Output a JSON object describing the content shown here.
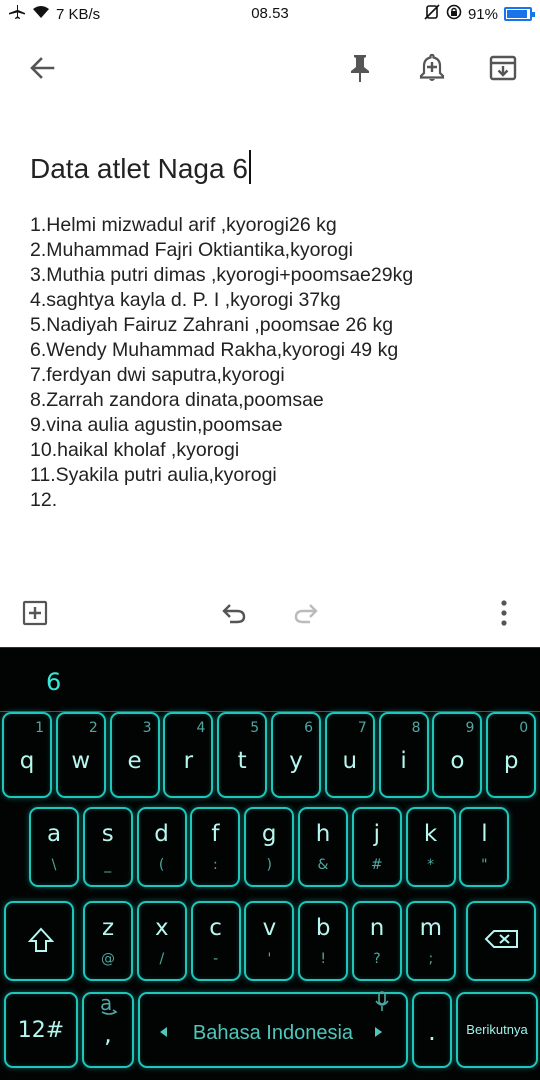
{
  "status_bar": {
    "speed": "7 KB/s",
    "time": "08.53",
    "battery": "91%",
    "battery_level": 0.91
  },
  "toolbar": {
    "back_icon": "arrow-left-icon",
    "pin_icon": "pin-icon",
    "reminder_icon": "bell-plus-icon",
    "archive_icon": "archive-icon"
  },
  "note": {
    "title": "Data atlet Naga 6",
    "lines": [
      "1.Helmi mizwadul arif ,kyorogi26 kg",
      "2.Muhammad Fajri Oktiantika,kyorogi",
      "3.Muthia putri dimas ,kyorogi+poomsae29kg",
      "4.saghtya kayla d. P. I ,kyorogi 37kg",
      "5.Nadiyah Fairuz Zahrani ,poomsae 26 kg",
      "6.Wendy Muhammad Rakha,kyorogi 49 kg",
      "7.ferdyan dwi saputra,kyorogi",
      "8.Zarrah zandora dinata,poomsae",
      "9.vina aulia agustin,poomsae",
      "10.haikal kholaf ,kyorogi",
      "11.Syakila putri aulia,kyorogi",
      "12."
    ]
  },
  "keyboard": {
    "suggestion": "6",
    "row1": [
      {
        "key": "q",
        "num": "1"
      },
      {
        "key": "w",
        "num": "2"
      },
      {
        "key": "e",
        "num": "3"
      },
      {
        "key": "r",
        "num": "4"
      },
      {
        "key": "t",
        "num": "5"
      },
      {
        "key": "y",
        "num": "6"
      },
      {
        "key": "u",
        "num": "7"
      },
      {
        "key": "i",
        "num": "8"
      },
      {
        "key": "o",
        "num": "9"
      },
      {
        "key": "p",
        "num": "0"
      }
    ],
    "row2": [
      {
        "key": "a",
        "sym": "\\"
      },
      {
        "key": "s",
        "sym": "_"
      },
      {
        "key": "d",
        "sym": "("
      },
      {
        "key": "f",
        "sym": ":"
      },
      {
        "key": "g",
        "sym": ")"
      },
      {
        "key": "h",
        "sym": "&"
      },
      {
        "key": "j",
        "sym": "#"
      },
      {
        "key": "k",
        "sym": "*"
      },
      {
        "key": "l",
        "sym": "\""
      }
    ],
    "row3": [
      {
        "key": "z",
        "sym": "@"
      },
      {
        "key": "x",
        "sym": "/"
      },
      {
        "key": "c",
        "sym": "-"
      },
      {
        "key": "v",
        "sym": "'"
      },
      {
        "key": "b",
        "sym": "!"
      },
      {
        "key": "n",
        "sym": "?"
      },
      {
        "key": "m",
        "sym": ";"
      }
    ],
    "symbols_key": "12#",
    "comma_key": ",",
    "space_label": "Bahasa Indonesia",
    "period_key": ".",
    "enter_label": "Berikutnya"
  }
}
